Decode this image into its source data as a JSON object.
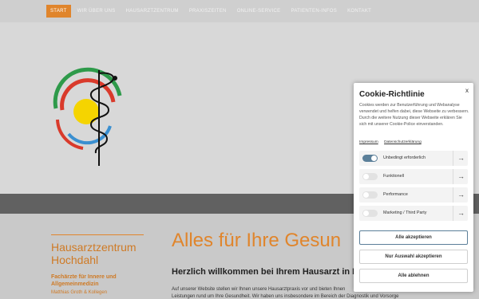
{
  "nav": {
    "items": [
      "Start",
      "Wir über uns",
      "Hausarztzentrum",
      "Praxiszeiten",
      "Online-Service",
      "Patienten-Infos",
      "Kontakt"
    ],
    "active": "Start"
  },
  "sidebar": {
    "title": "Hausarztzentrum Hochdahl",
    "subtitle": "Fachärzte für Innere und Allgemeinmedizin",
    "names": "Matthias Groth & Kollegen"
  },
  "main": {
    "heading": "Alles für Ihre Gesun",
    "subheading": "Herzlich willkommen bei Ihrem Hausarzt in Erkra",
    "para_line1": "Auf unserer Website stellen wir Ihnen unsere Hausarztpraxis vor und bieten Ihnen",
    "para_line2": "Leistungen rund um Ihre Gesundheit. Wir haben uns insbesondere im Bereich der Diagnostik und Vorsorge"
  },
  "cookie": {
    "title": "Cookie-Richtlinie",
    "close": "x",
    "text": "Cookies werden zur Benutzerführung und Webanalyse verwendet und helfen dabei, diese Webseite zu verbessern. Durch die weitere Nutzung dieser Webseite erklären Sie sich mit unserer Cookie-Police einverstanden.",
    "link_impressum": "Impressum",
    "link_datenschutz": "Datenschutzerklärung",
    "options": [
      {
        "label": "Unbedingt erforderlich",
        "on": true
      },
      {
        "label": "Funktionell",
        "on": false
      },
      {
        "label": "Performance",
        "on": false
      },
      {
        "label": "Marketing / Third Party",
        "on": false
      }
    ],
    "arrow": "→",
    "btn_accept_all": "Alle akzeptieren",
    "btn_accept_selection": "Nur Auswahl akzeptieren",
    "btn_reject_all": "Alle ablehnen"
  },
  "colors": {
    "accent": "#e0852c",
    "toggle_on": "#5b7f99",
    "logo_green": "#2e9a4a",
    "logo_red": "#d93a2b",
    "logo_blue": "#3a8fd0",
    "logo_yellow": "#f5d400"
  },
  "icons": {
    "logo": "caduceus-logo-icon",
    "close": "close-icon",
    "arrow": "arrow-right-icon"
  }
}
